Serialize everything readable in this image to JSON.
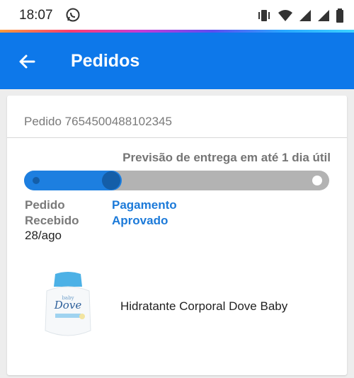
{
  "status_bar": {
    "time": "18:07"
  },
  "app_bar": {
    "title": "Pedidos"
  },
  "order": {
    "number_text": "Pedido 7654500488102345",
    "forecast": "Previsão de entrega em até 1 dia útil",
    "progress_fraction": 0.32,
    "steps": [
      {
        "label_line1": "Pedido",
        "label_line2": "Recebido",
        "date": "28/ago"
      },
      {
        "label_line1": "Pagamento",
        "label_line2": "Aprovado"
      }
    ],
    "product": {
      "name": "Hidratante Corporal Dove Baby",
      "image_text_brand": "Dove",
      "image_text_line": "baby"
    }
  },
  "colors": {
    "app_bar": "#0d78ea",
    "progress_active": "#1d7fe0",
    "progress_inactive": "#b3b3b3",
    "active_step_text": "#1c7ad9"
  },
  "icons": {
    "status": [
      "whatsapp-icon",
      "vibrate-icon",
      "wifi-icon",
      "signal-icon",
      "battery-icon"
    ],
    "app_bar": "back-arrow-icon"
  }
}
